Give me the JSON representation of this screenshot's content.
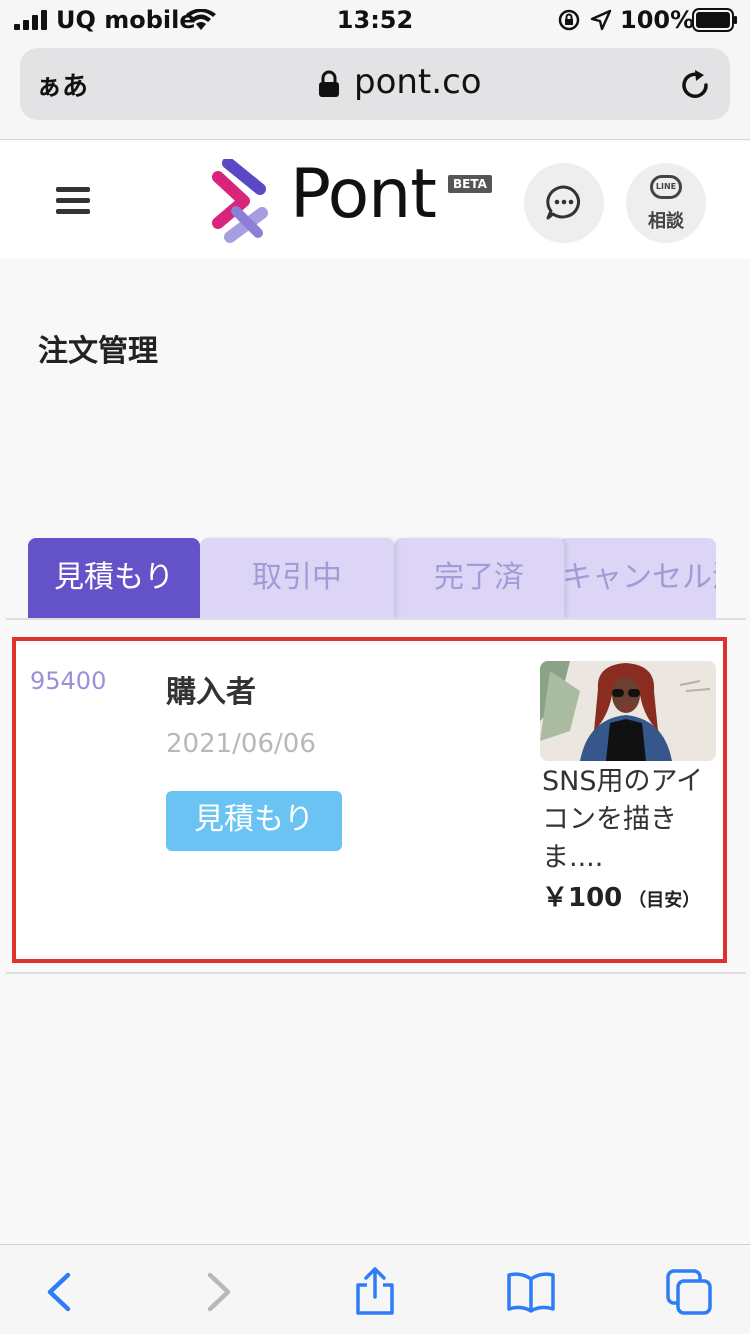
{
  "status_bar": {
    "carrier": "UQ mobile",
    "time": "13:52",
    "battery": "100%"
  },
  "browser": {
    "aa_label": "ぁあ",
    "url": "pont.co"
  },
  "header": {
    "logo_text": "Pont",
    "beta_label": "BETA",
    "line_bubble": "LINE",
    "line_label": "相談"
  },
  "page": {
    "title": "注文管理"
  },
  "tabs": [
    {
      "label": "見積もり",
      "active": true
    },
    {
      "label": "取引中",
      "active": false
    },
    {
      "label": "完了済",
      "active": false
    },
    {
      "label": "キャンセル済",
      "active": false
    }
  ],
  "orders": [
    {
      "id": "95400",
      "buyer": "購入者",
      "date": "2021/06/06",
      "status": "見積もり",
      "product_title": "SNS用のアイコンを描きま....",
      "price": "￥100",
      "price_note": "（目安）"
    }
  ],
  "colors": {
    "brand_purple": "#6452c9",
    "tab_inactive_bg": "#dcd5f6",
    "status_blue": "#6bc3f4",
    "highlight_red": "#e0322c",
    "ios_blue": "#2f7df6"
  }
}
